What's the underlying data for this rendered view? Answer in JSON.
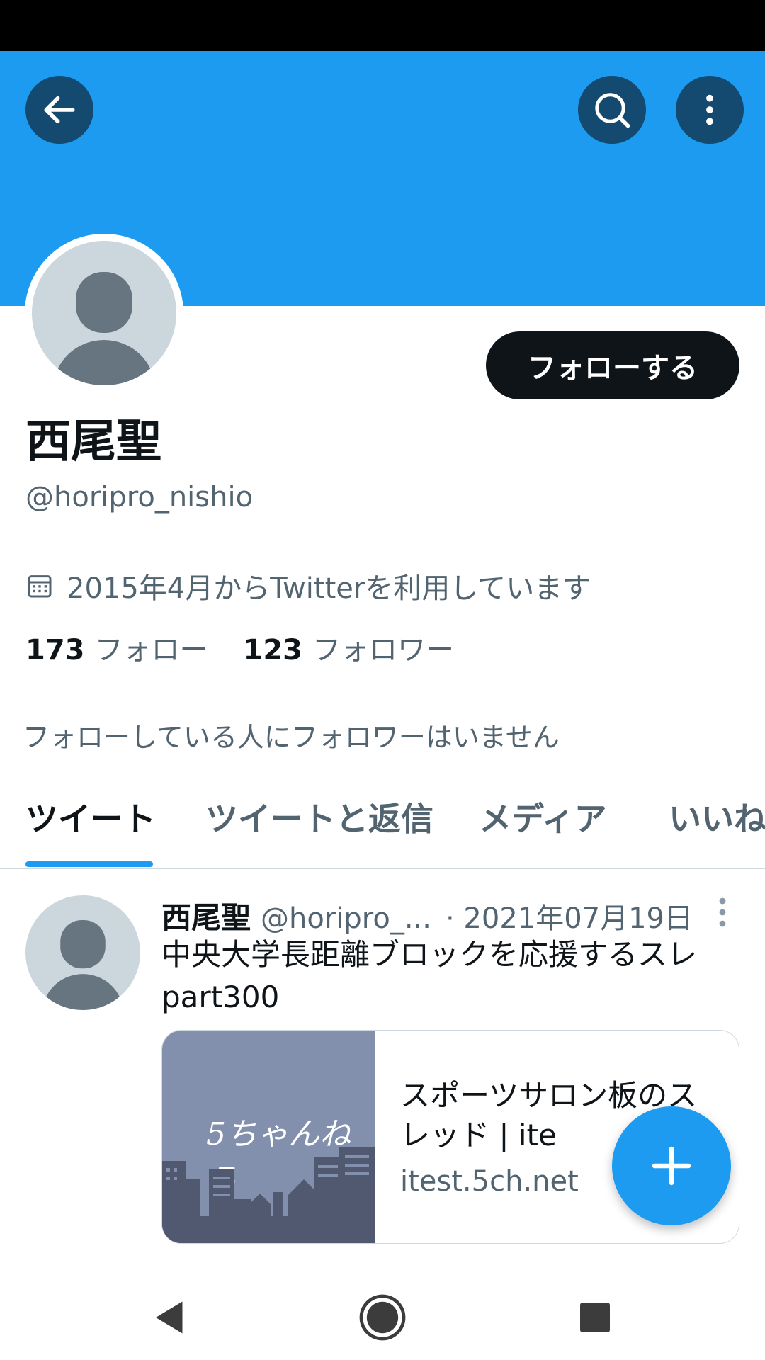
{
  "profile": {
    "display_name": "西尾聖",
    "handle": "@horipro_nishio",
    "joined": "2015年4月からTwitterを利用しています",
    "following_count": "173",
    "following_label": "フォロー",
    "followers_count": "123",
    "followers_label": "フォロワー",
    "follow_button": "フォローする",
    "no_mutual_followers": "フォローしている人にフォロワーはいません"
  },
  "header": {
    "back_icon": "arrow-left-icon",
    "search_icon": "search-icon",
    "more_icon": "more-vertical-icon"
  },
  "tabs": [
    {
      "label": "ツイート",
      "active": true
    },
    {
      "label": "ツイートと返信",
      "active": false
    },
    {
      "label": "メディア",
      "active": false
    },
    {
      "label": "いいね",
      "active": false
    }
  ],
  "tweet": {
    "name": "西尾聖",
    "handle": "@horipro_...",
    "date": "· 2021年07月19日",
    "text_line1": "中央大学長距離ブロックを応援するスレ",
    "text_line2": "part300",
    "card": {
      "logo": "5ちゃんねる",
      "title": "スポーツサロン板のスレッド | ite",
      "domain": "itest.5ch.net"
    }
  },
  "colors": {
    "accent": "#1d9bf0",
    "text_primary": "#0f1419",
    "text_secondary": "#536471"
  },
  "nav": {
    "back_icon": "nav-back-icon",
    "home_icon": "nav-home-icon",
    "recents_icon": "nav-recents-icon"
  }
}
